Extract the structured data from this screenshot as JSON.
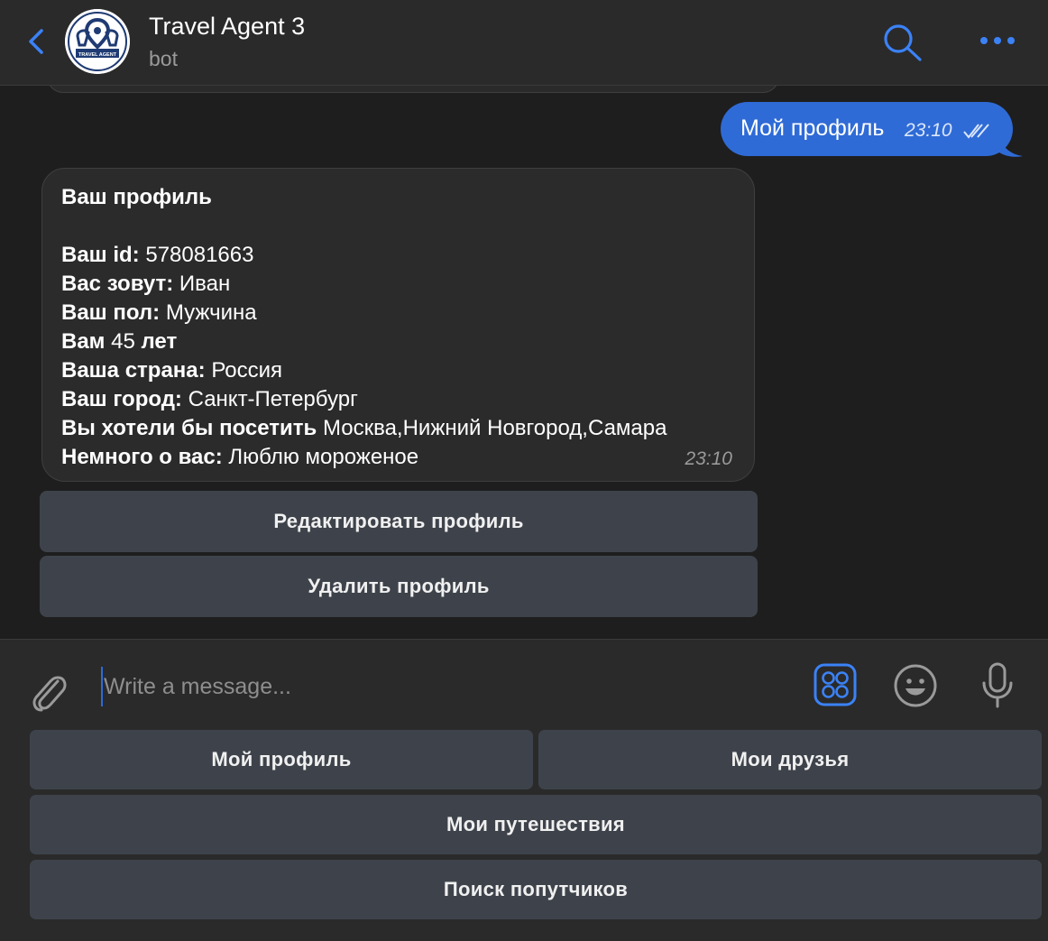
{
  "header": {
    "title": "Travel Agent 3",
    "subtitle": "bot",
    "avatar_text": "TRAVEL AGENT"
  },
  "outgoing": {
    "text": "Мой профиль",
    "time": "23:10"
  },
  "profile_message": {
    "title": "Ваш профиль",
    "lines": [
      {
        "label": "Ваш id:",
        "value": "578081663",
        "suffix": ""
      },
      {
        "label": "Вас зовут:",
        "value": "Иван",
        "suffix": ""
      },
      {
        "label": "Ваш пол:",
        "value": "Мужчина",
        "suffix": ""
      },
      {
        "label": "Вам",
        "value": "45",
        "suffix": "лет"
      },
      {
        "label": "Ваша страна:",
        "value": "Россия",
        "suffix": ""
      },
      {
        "label": "Ваш город:",
        "value": "Санкт-Петербург",
        "suffix": ""
      },
      {
        "label": "Вы хотели бы посетить",
        "value": "Москва,Нижний Новгород,Самара",
        "suffix": ""
      },
      {
        "label": "Немного о вас:",
        "value": "Люблю мороженое",
        "suffix": ""
      }
    ],
    "time": "23:10"
  },
  "inline_buttons": [
    "Редактировать профиль",
    "Удалить профиль"
  ],
  "composer": {
    "placeholder": "Write a message..."
  },
  "keyboard": {
    "rows": [
      [
        "Мой профиль",
        "Мои друзья"
      ],
      [
        "Мои путешествия"
      ],
      [
        "Поиск попутчиков"
      ]
    ]
  },
  "colors": {
    "accent": "#2f6bd6",
    "background": "#1e1e1e",
    "panel": "#2a2a2a",
    "button": "#3e434b"
  }
}
